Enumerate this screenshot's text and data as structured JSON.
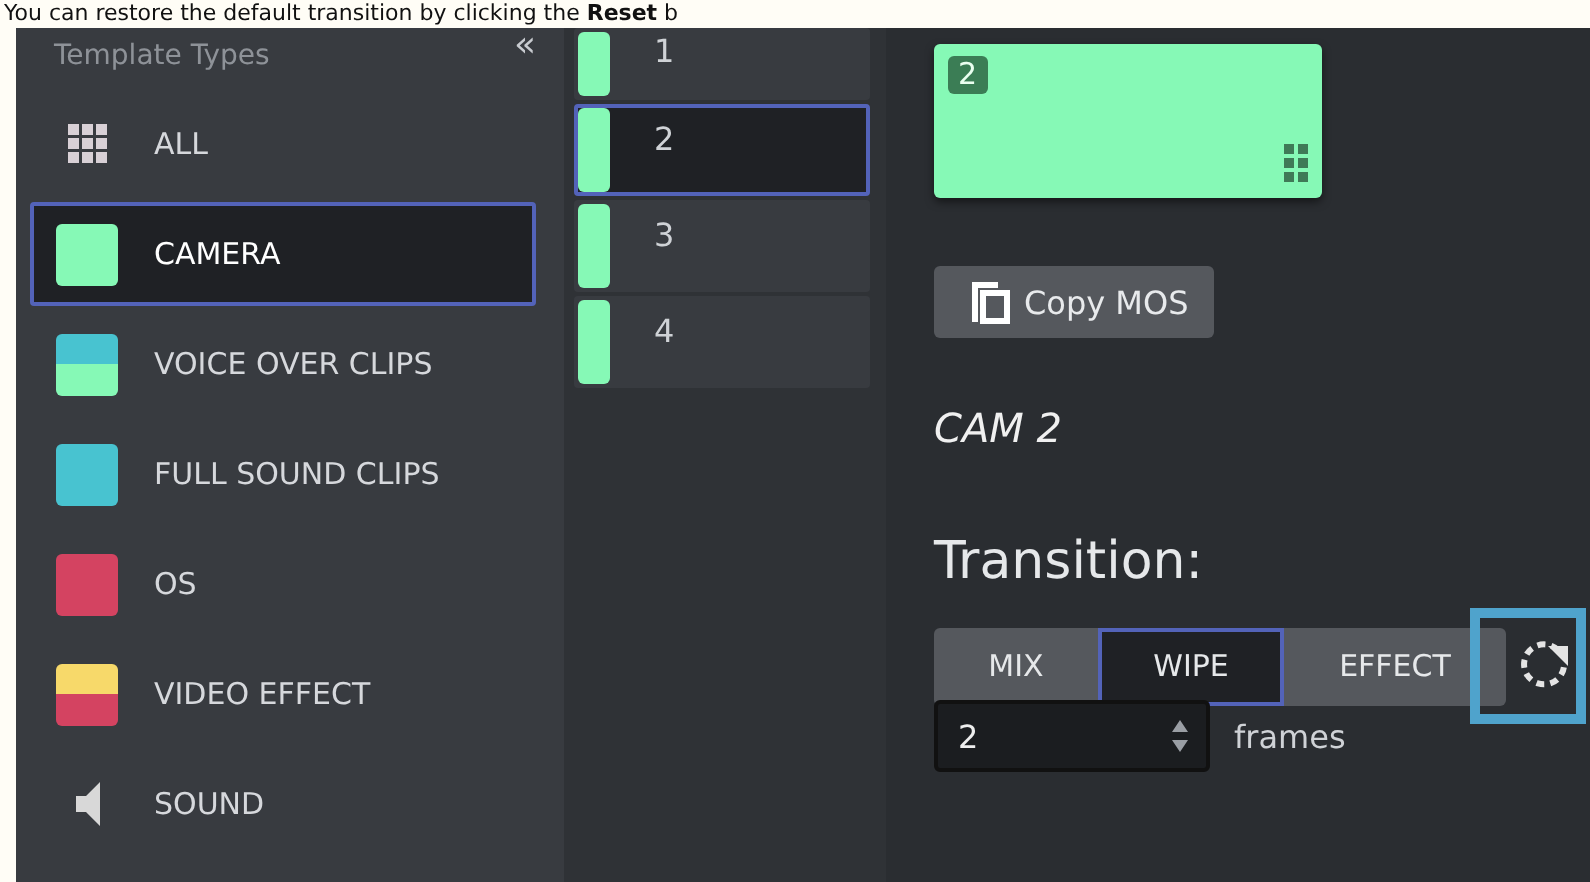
{
  "caption": "You can restore the default transition by clicking the **Reset** b",
  "sidebar": {
    "title": "Template Types",
    "collapse": "«",
    "items": [
      {
        "kind": "grid",
        "label": "ALL",
        "selected": false
      },
      {
        "kind": "swatch",
        "label": "CAMERA",
        "bands": [
          {
            "color": "#86f9b6"
          }
        ],
        "selected": true
      },
      {
        "kind": "swatch",
        "label": "VOICE OVER CLIPS",
        "bands": [
          {
            "color": "#48c3d0"
          },
          {
            "color": "#86f9b6"
          }
        ],
        "selected": false
      },
      {
        "kind": "swatch",
        "label": "FULL SOUND CLIPS",
        "bands": [
          {
            "color": "#48c3d0"
          }
        ],
        "selected": false
      },
      {
        "kind": "swatch",
        "label": "OS",
        "bands": [
          {
            "color": "#d44361"
          }
        ],
        "selected": false
      },
      {
        "kind": "swatch",
        "label": "VIDEO EFFECT",
        "bands": [
          {
            "color": "#f7d96a"
          },
          {
            "color": "#d44361"
          }
        ],
        "selected": false
      },
      {
        "kind": "speaker",
        "label": "SOUND",
        "selected": false
      }
    ]
  },
  "templates": [
    {
      "label": "1",
      "color": "#86f9b6",
      "selected": false
    },
    {
      "label": "2",
      "color": "#86f9b6",
      "selected": true
    },
    {
      "label": "3",
      "color": "#86f9b6",
      "selected": false
    },
    {
      "label": "4",
      "color": "#86f9b6",
      "selected": false
    }
  ],
  "detail": {
    "card": {
      "badge": "2",
      "color": "#86f9b6"
    },
    "copy_button": "Copy MOS",
    "name": "CAM 2",
    "transition_label": "Transition:",
    "transitions": [
      {
        "label": "MIX",
        "selected": false
      },
      {
        "label": "WIPE",
        "selected": true
      },
      {
        "label": "EFFECT",
        "selected": false
      }
    ],
    "reset_highlighted": true,
    "frames": {
      "value": "2",
      "unit": "frames"
    }
  }
}
